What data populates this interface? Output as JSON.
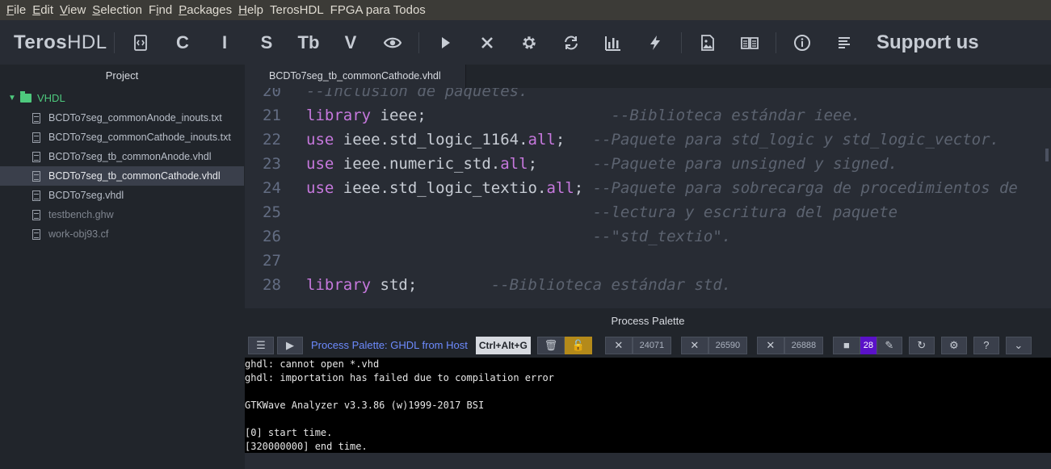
{
  "menu": [
    {
      "pre": "",
      "u": "F",
      "post": "ile"
    },
    {
      "pre": "",
      "u": "E",
      "post": "dit"
    },
    {
      "pre": "",
      "u": "V",
      "post": "iew"
    },
    {
      "pre": "",
      "u": "S",
      "post": "election"
    },
    {
      "pre": "F",
      "u": "i",
      "post": "nd"
    },
    {
      "pre": "",
      "u": "P",
      "post": "ackages"
    },
    {
      "pre": "",
      "u": "H",
      "post": "elp"
    },
    {
      "pre": "TerosHDL",
      "u": "",
      "post": ""
    },
    {
      "pre": "FPGA para Todos",
      "u": "",
      "post": ""
    }
  ],
  "toolbar": {
    "logo_bold": "Teros",
    "logo_rest": "HDL",
    "btn_c": "C",
    "btn_i": "I",
    "btn_s": "S",
    "btn_tb": "Tb",
    "btn_v": "V",
    "support": "Support us"
  },
  "sidebar": {
    "title": "Project",
    "folder": "VHDL",
    "files": [
      {
        "name": "BCDTo7seg_commonAnode_inouts.txt",
        "state": "normal"
      },
      {
        "name": "BCDTo7seg_commonCathode_inouts.txt",
        "state": "normal"
      },
      {
        "name": "BCDTo7seg_tb_commonAnode.vhdl",
        "state": "normal"
      },
      {
        "name": "BCDTo7seg_tb_commonCathode.vhdl",
        "state": "selected"
      },
      {
        "name": "BCDTo7seg.vhdl",
        "state": "normal"
      },
      {
        "name": "testbench.ghw",
        "state": "dim"
      },
      {
        "name": "work-obj93.cf",
        "state": "dim"
      }
    ]
  },
  "editor": {
    "tab": "BCDTo7seg_tb_commonCathode.vhdl",
    "lines": [
      {
        "n": "20",
        "kw": "",
        "code": "",
        "pad": "",
        "comment": "--Inclusión de paquetes."
      },
      {
        "n": "21",
        "kw": "library",
        "code": " ieee;",
        "pad": "                    ",
        "comment": "--Biblioteca estándar ieee."
      },
      {
        "n": "22",
        "kw": "use",
        "code": " ieee.std_logic_1164.",
        "kw2": "all",
        "code2": ";",
        "pad": "   ",
        "comment": "--Paquete para std_logic y std_logic_vector."
      },
      {
        "n": "23",
        "kw": "use",
        "code": " ieee.numeric_std.",
        "kw2": "all",
        "code2": ";",
        "pad": "      ",
        "comment": "--Paquete para unsigned y signed."
      },
      {
        "n": "24",
        "kw": "use",
        "code": " ieee.std_logic_textio.",
        "kw2": "all",
        "code2": ";",
        "pad": " ",
        "comment": "--Paquete para sobrecarga de procedimientos de"
      },
      {
        "n": "25",
        "kw": "",
        "code": "",
        "pad": "                               ",
        "comment": "--lectura y escritura del paquete"
      },
      {
        "n": "26",
        "kw": "",
        "code": "",
        "pad": "                               ",
        "comment": "--\"std_textio\"."
      },
      {
        "n": "27",
        "kw": "",
        "code": "",
        "pad": "",
        "comment": ""
      },
      {
        "n": "28",
        "kw": "library",
        "code": " std;",
        "pad": "        ",
        "comment": "--Biblioteca estándar std."
      }
    ]
  },
  "palette": {
    "title": "Process Palette",
    "label": "Process Palette: GHDL from Host",
    "shortcut": "Ctrl+Alt+G",
    "pids": [
      "24071",
      "26590",
      "26888",
      "28"
    ],
    "console": [
      "ghdl: cannot open *.vhd",
      "ghdl: importation has failed due to compilation error",
      "",
      "GTKWave Analyzer v3.3.86 (w)1999-2017 BSI",
      "",
      "[0] start time.",
      "[320000000] end time."
    ]
  }
}
